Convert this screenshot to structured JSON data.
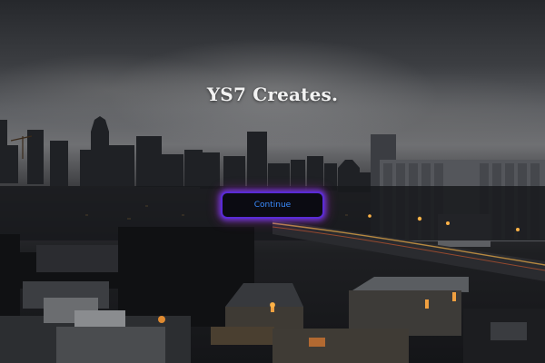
{
  "hero": {
    "title": "YS7 Creates.",
    "continue_label": "Continue"
  },
  "colors": {
    "button_border": "#5a2bd6",
    "button_text": "#3a8cff",
    "button_bg": "#0b0b12"
  }
}
